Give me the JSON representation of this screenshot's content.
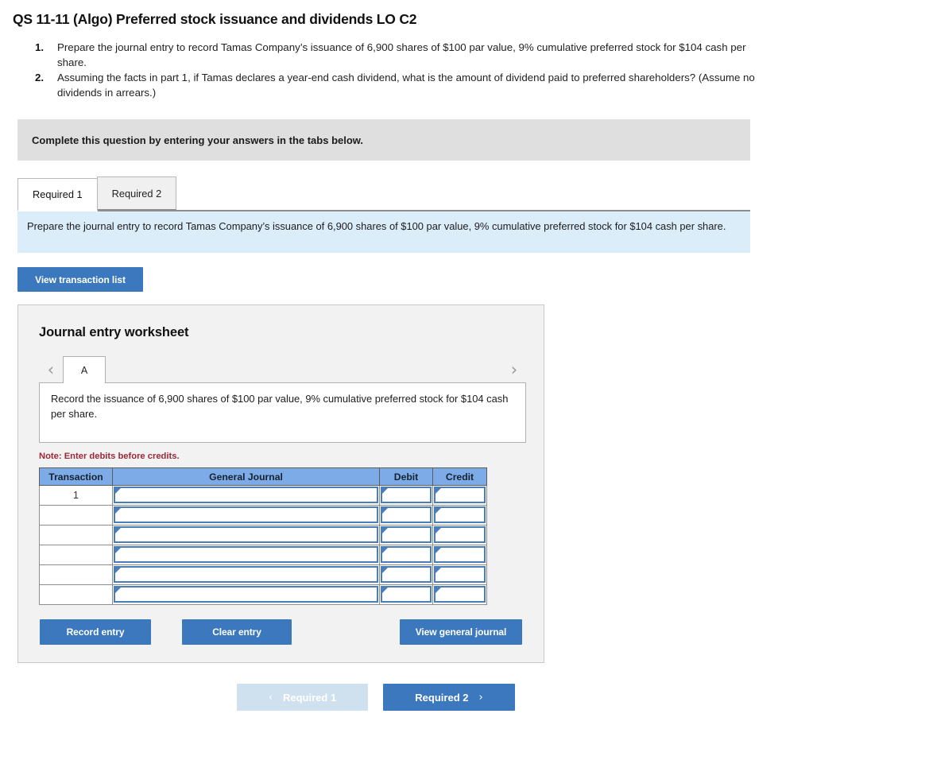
{
  "page_title": "QS 11-11 (Algo) Preferred stock issuance and dividends LO C2",
  "requirements": [
    {
      "num": "1.",
      "text": "Prepare the journal entry to record Tamas Company’s issuance of 6,900 shares of $100 par value, 9% cumulative preferred stock for $104 cash per share."
    },
    {
      "num": "2.",
      "text": "Assuming the facts in part 1, if Tamas declares a year-end cash dividend, what is the amount of dividend paid to preferred shareholders? (Assume no dividends in arrears.)"
    }
  ],
  "complete_bar": {
    "text": "Complete this question by entering your answers in the tabs below."
  },
  "tabs": [
    {
      "label": "Required 1",
      "active": true
    },
    {
      "label": "Required 2",
      "active": false
    }
  ],
  "prompt": {
    "text": "Prepare the journal entry to record Tamas Company’s issuance of 6,900 shares of $100 par value, 9% cumulative preferred stock for $104 cash per share."
  },
  "view_transaction_list_label": "View transaction list",
  "worksheet": {
    "title": "Journal entry worksheet",
    "prev_arrow": "‹",
    "next_arrow": "›",
    "entry_tabs": [
      {
        "label": "A",
        "active": true
      }
    ],
    "description": "Record the issuance of 6,900 shares of $100 par value, 9% cumulative preferred stock for $104 cash per share.",
    "note": "Note: Enter debits before credits.",
    "table": {
      "headers": [
        "Transaction",
        "General Journal",
        "Debit",
        "Credit"
      ],
      "rows": [
        {
          "transaction": "1",
          "general_journal": "",
          "debit": "",
          "credit": ""
        },
        {
          "transaction": "",
          "general_journal": "",
          "debit": "",
          "credit": ""
        },
        {
          "transaction": "",
          "general_journal": "",
          "debit": "",
          "credit": ""
        },
        {
          "transaction": "",
          "general_journal": "",
          "debit": "",
          "credit": ""
        },
        {
          "transaction": "",
          "general_journal": "",
          "debit": "",
          "credit": ""
        },
        {
          "transaction": "",
          "general_journal": "",
          "debit": "",
          "credit": ""
        }
      ]
    },
    "actions": {
      "record_entry": "Record entry",
      "clear_entry": "Clear entry",
      "view_general_journal": "View general journal"
    }
  },
  "bottom_nav": {
    "prev_label": "Required 1",
    "prev_chevron": "‹",
    "next_label": "Required 2",
    "next_chevron": "›"
  },
  "colors": {
    "button_blue": "#3c78bd",
    "button_blue_disabled": "#cfe0ef",
    "table_header_blue": "#7dabe8",
    "input_border_blue": "#4a7ebb",
    "panel_gray": "#dfdfdf",
    "prompt_blue": "#dcedfa",
    "note_red": "#9c2738"
  }
}
